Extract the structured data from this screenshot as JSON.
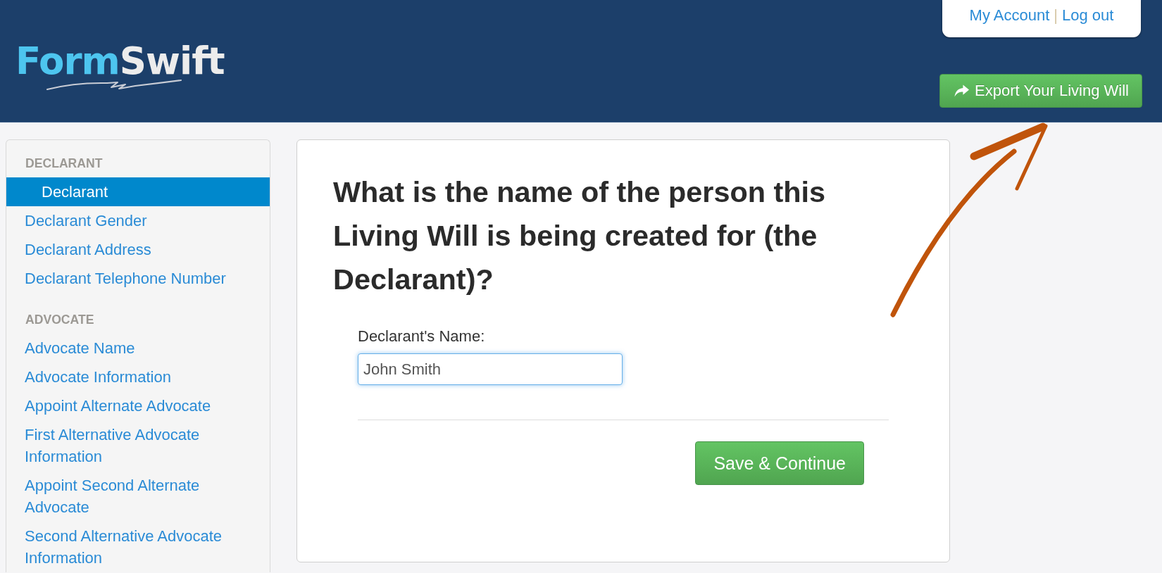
{
  "header": {
    "logo": {
      "parts": [
        "Form",
        "Swift"
      ]
    },
    "account_links": [
      {
        "label": "My Account"
      },
      {
        "label": "Log out"
      }
    ],
    "separator": "|",
    "export_button": {
      "label": "Export Your Living Will"
    }
  },
  "sidebar": {
    "sections": [
      {
        "heading": "DECLARANT",
        "items": [
          {
            "label": "Declarant",
            "selected": true
          },
          {
            "label": "Declarant Gender",
            "selected": false
          },
          {
            "label": "Declarant Address",
            "selected": false
          },
          {
            "label": "Declarant Telephone Number",
            "selected": false
          }
        ]
      },
      {
        "heading": "ADVOCATE",
        "items": [
          {
            "label": "Advocate Name",
            "selected": false
          },
          {
            "label": "Advocate Information",
            "selected": false
          },
          {
            "label": "Appoint Alternate Advocate",
            "selected": false
          },
          {
            "label": "First Alternative Advocate Information",
            "selected": false
          },
          {
            "label": "Appoint Second Alternate Advocate",
            "selected": false
          },
          {
            "label": "Second Alternative Advocate Information",
            "selected": false
          }
        ]
      }
    ]
  },
  "form": {
    "question": "What is the name of the person this Living Will is being created for (the Declarant)?",
    "field": {
      "label": "Declarant's Name:",
      "value": "John Smith",
      "focused": true
    },
    "submit_button": {
      "label": "Save & Continue"
    }
  }
}
